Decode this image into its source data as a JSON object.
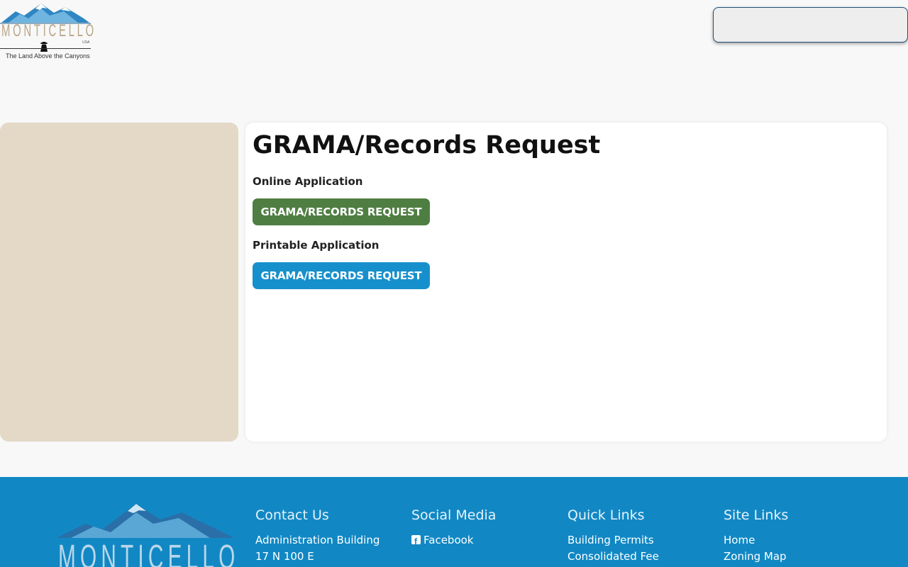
{
  "header": {
    "logo": {
      "wordmark": "MONTICELLO",
      "country": "USA",
      "tagline": "The Land Above the Canyons"
    },
    "search": {
      "placeholder": ""
    }
  },
  "main": {
    "title": "GRAMA/Records Request",
    "sections": [
      {
        "label": "Online Application",
        "button_label": "GRAMA/RECORDS REQUEST",
        "button_color": "#4f7e43"
      },
      {
        "label": "Printable Application",
        "button_label": "GRAMA/RECORDS REQUEST",
        "button_color": "#1690cc"
      }
    ]
  },
  "footer": {
    "logo_wordmark": "MONTICELLO",
    "columns": [
      {
        "heading": "Contact Us",
        "lines": [
          "Administration Building",
          "17 N 100 E"
        ]
      },
      {
        "heading": "Social Media",
        "lines": [
          "Facebook"
        ]
      },
      {
        "heading": "Quick Links",
        "lines": [
          "Building Permits",
          "Consolidated Fee"
        ]
      },
      {
        "heading": "Site Links",
        "lines": [
          "Home",
          "Zoning Map"
        ]
      }
    ]
  },
  "colors": {
    "page_bg": "#f8f8f8",
    "sidebar_bg": "#e3d9c6",
    "footer_bg": "#1188c4",
    "green_button": "#4f7e43",
    "blue_button": "#1690cc"
  },
  "icons": [
    "mountain-logo-icon",
    "cowboy-silhouette-icon",
    "facebook-icon"
  ]
}
